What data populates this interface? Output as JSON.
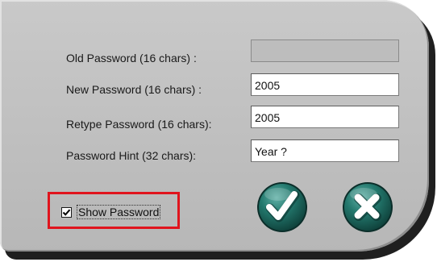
{
  "form": {
    "old_password": {
      "label": "Old Password (16 chars) :",
      "value": "",
      "disabled": true
    },
    "new_password": {
      "label": "New Password (16 chars) :",
      "value": "2005"
    },
    "retype_password": {
      "label": "Retype Password (16 chars):",
      "value": "2005"
    },
    "password_hint": {
      "label": "Password Hint (32 chars):",
      "value": "Year ?"
    }
  },
  "show_password": {
    "label": "Show Password",
    "checked": true
  },
  "buttons": {
    "ok_icon": "checkmark-icon",
    "cancel_icon": "close-icon"
  },
  "colors": {
    "panel": "#bfbfbf",
    "button_green": "#1f6f66",
    "highlight": "#e0141d"
  }
}
